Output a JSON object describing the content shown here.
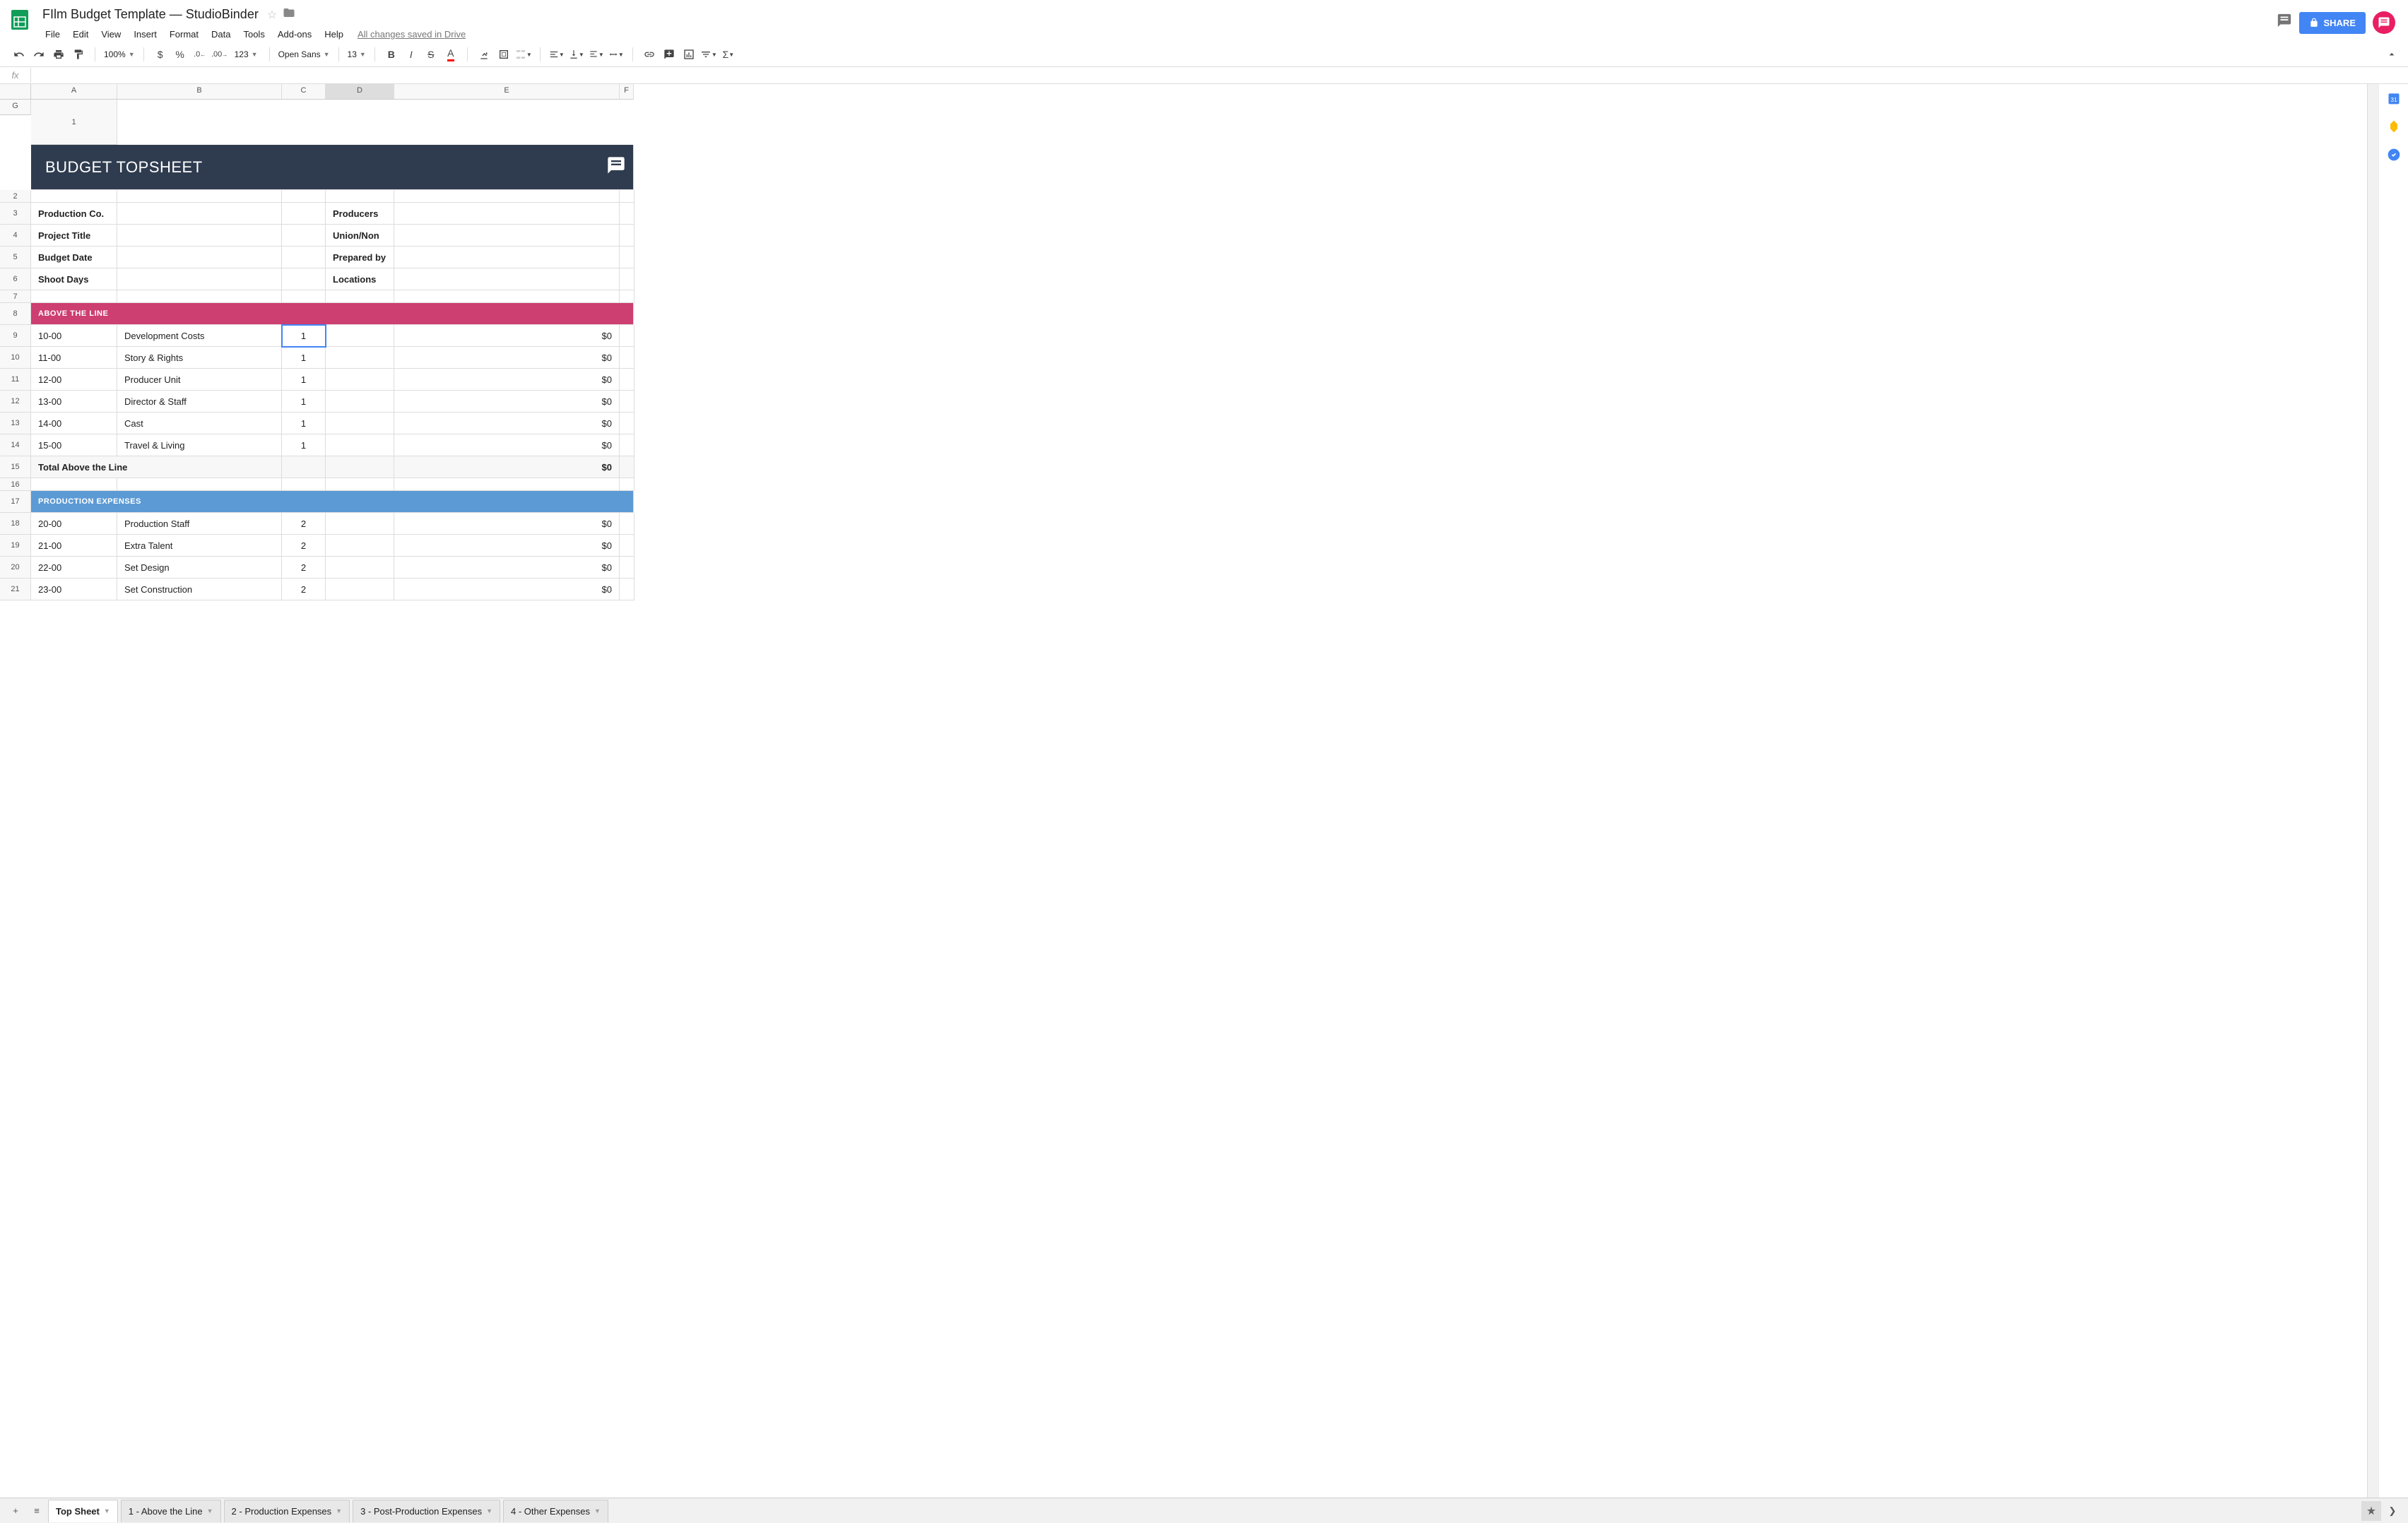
{
  "doc": {
    "title": "FIlm Budget Template — StudioBinder"
  },
  "menus": [
    "File",
    "Edit",
    "View",
    "Insert",
    "Format",
    "Data",
    "Tools",
    "Add-ons",
    "Help"
  ],
  "save_status": "All changes saved in Drive",
  "share_label": "SHARE",
  "toolbar": {
    "zoom": "100%",
    "font": "Open Sans",
    "font_size": "13",
    "format_123": "123"
  },
  "fx_label": "fx",
  "columns": [
    "A",
    "B",
    "C",
    "D",
    "E",
    "F",
    "G"
  ],
  "selected_col": "D",
  "sheet": {
    "title": "BUDGET TOPSHEET",
    "info": [
      {
        "left": "Production Co.",
        "right": "Producers"
      },
      {
        "left": "Project Title",
        "right": "Union/Non"
      },
      {
        "left": "Budget Date",
        "right": "Prepared by"
      },
      {
        "left": "Shoot Days",
        "right": "Locations"
      }
    ],
    "above_header": "ABOVE THE LINE",
    "above_rows": [
      {
        "code": "10-00",
        "name": "Development Costs",
        "page": "1",
        "amt": "$0"
      },
      {
        "code": "11-00",
        "name": "Story & Rights",
        "page": "1",
        "amt": "$0"
      },
      {
        "code": "12-00",
        "name": "Producer Unit",
        "page": "1",
        "amt": "$0"
      },
      {
        "code": "13-00",
        "name": "Director & Staff",
        "page": "1",
        "amt": "$0"
      },
      {
        "code": "14-00",
        "name": "Cast",
        "page": "1",
        "amt": "$0"
      },
      {
        "code": "15-00",
        "name": "Travel & Living",
        "page": "1",
        "amt": "$0"
      }
    ],
    "above_total_label": "Total Above the Line",
    "above_total_amt": "$0",
    "prod_header": "PRODUCTION EXPENSES",
    "prod_rows": [
      {
        "code": "20-00",
        "name": "Production Staff",
        "page": "2",
        "amt": "$0"
      },
      {
        "code": "21-00",
        "name": "Extra Talent",
        "page": "2",
        "amt": "$0"
      },
      {
        "code": "22-00",
        "name": "Set Design",
        "page": "2",
        "amt": "$0"
      },
      {
        "code": "23-00",
        "name": "Set Construction",
        "page": "2",
        "amt": "$0"
      }
    ]
  },
  "tabs": [
    "Top Sheet",
    "1 - Above the Line",
    "2 - Production Expenses",
    "3 - Post-Production Expenses",
    "4 - Other Expenses"
  ],
  "active_tab": 0
}
